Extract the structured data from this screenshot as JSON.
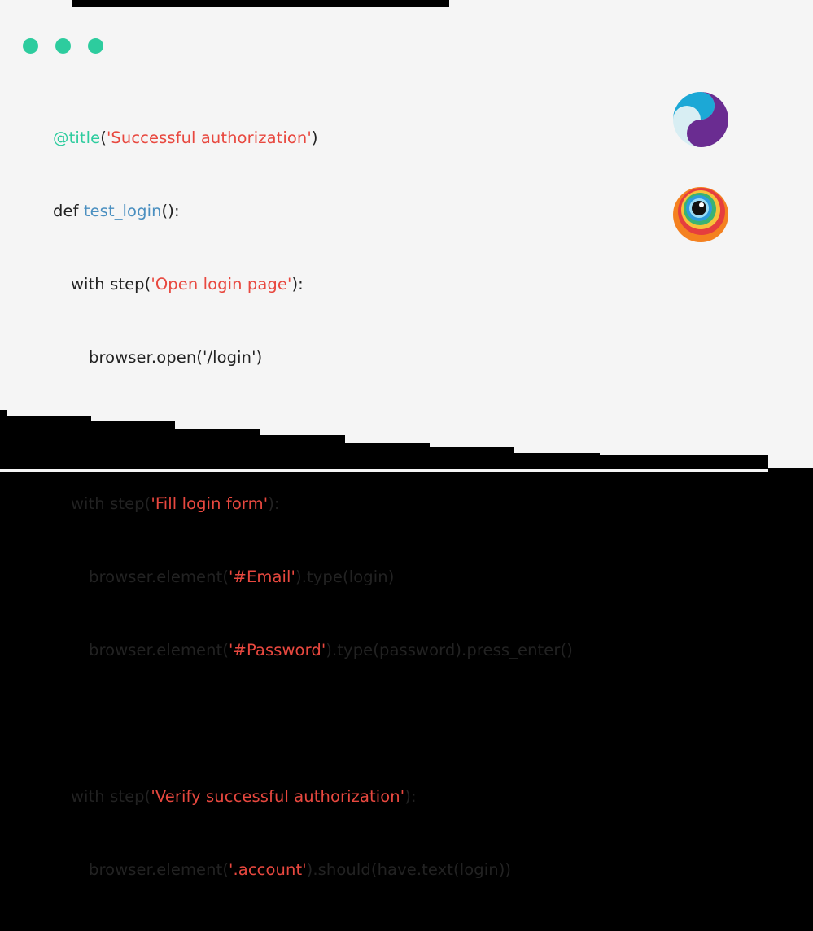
{
  "window": {
    "controls": [
      "dot-1",
      "dot-2",
      "dot-3"
    ],
    "control_color": "#2dcc9e"
  },
  "code": {
    "decorator": "@title",
    "decorator_arg": "'Successful authorization'",
    "def_kw": "def ",
    "func_name": "test_login",
    "func_tail": "():",
    "step1_label": "'Open login page'",
    "step1_body": "browser.open('/login')",
    "step2_label": "'Fill login form'",
    "step2_l1_sel": "'#Email'",
    "step2_l1_tail": ").type(login)",
    "step2_l2_sel": "'#Password'",
    "step2_l2_tail": ").type(password).press_enter()",
    "step3_label": "'Verify successful authorization'",
    "step3_sel": "'.account'",
    "step3_tail": ").should(have.text(login))",
    "with_step": "with step(",
    "paren_colon": "):",
    "open_paren": "(",
    "close_paren": ")",
    "element_call": "browser.element("
  },
  "logos": [
    {
      "name": "selenoid-logo",
      "colors": [
        "#1ca8d6",
        "#6a2c91",
        "#d8eef3"
      ]
    },
    {
      "name": "browserstack-logo",
      "colors": [
        "#f48120",
        "#e53e3e",
        "#3bb273",
        "#2d9cdb"
      ]
    }
  ],
  "colors": {
    "decorator": "#2dcc9e",
    "string": "#e8483f",
    "function": "#4a8fc0",
    "text": "#222222",
    "panel": "#f5f5f5"
  }
}
